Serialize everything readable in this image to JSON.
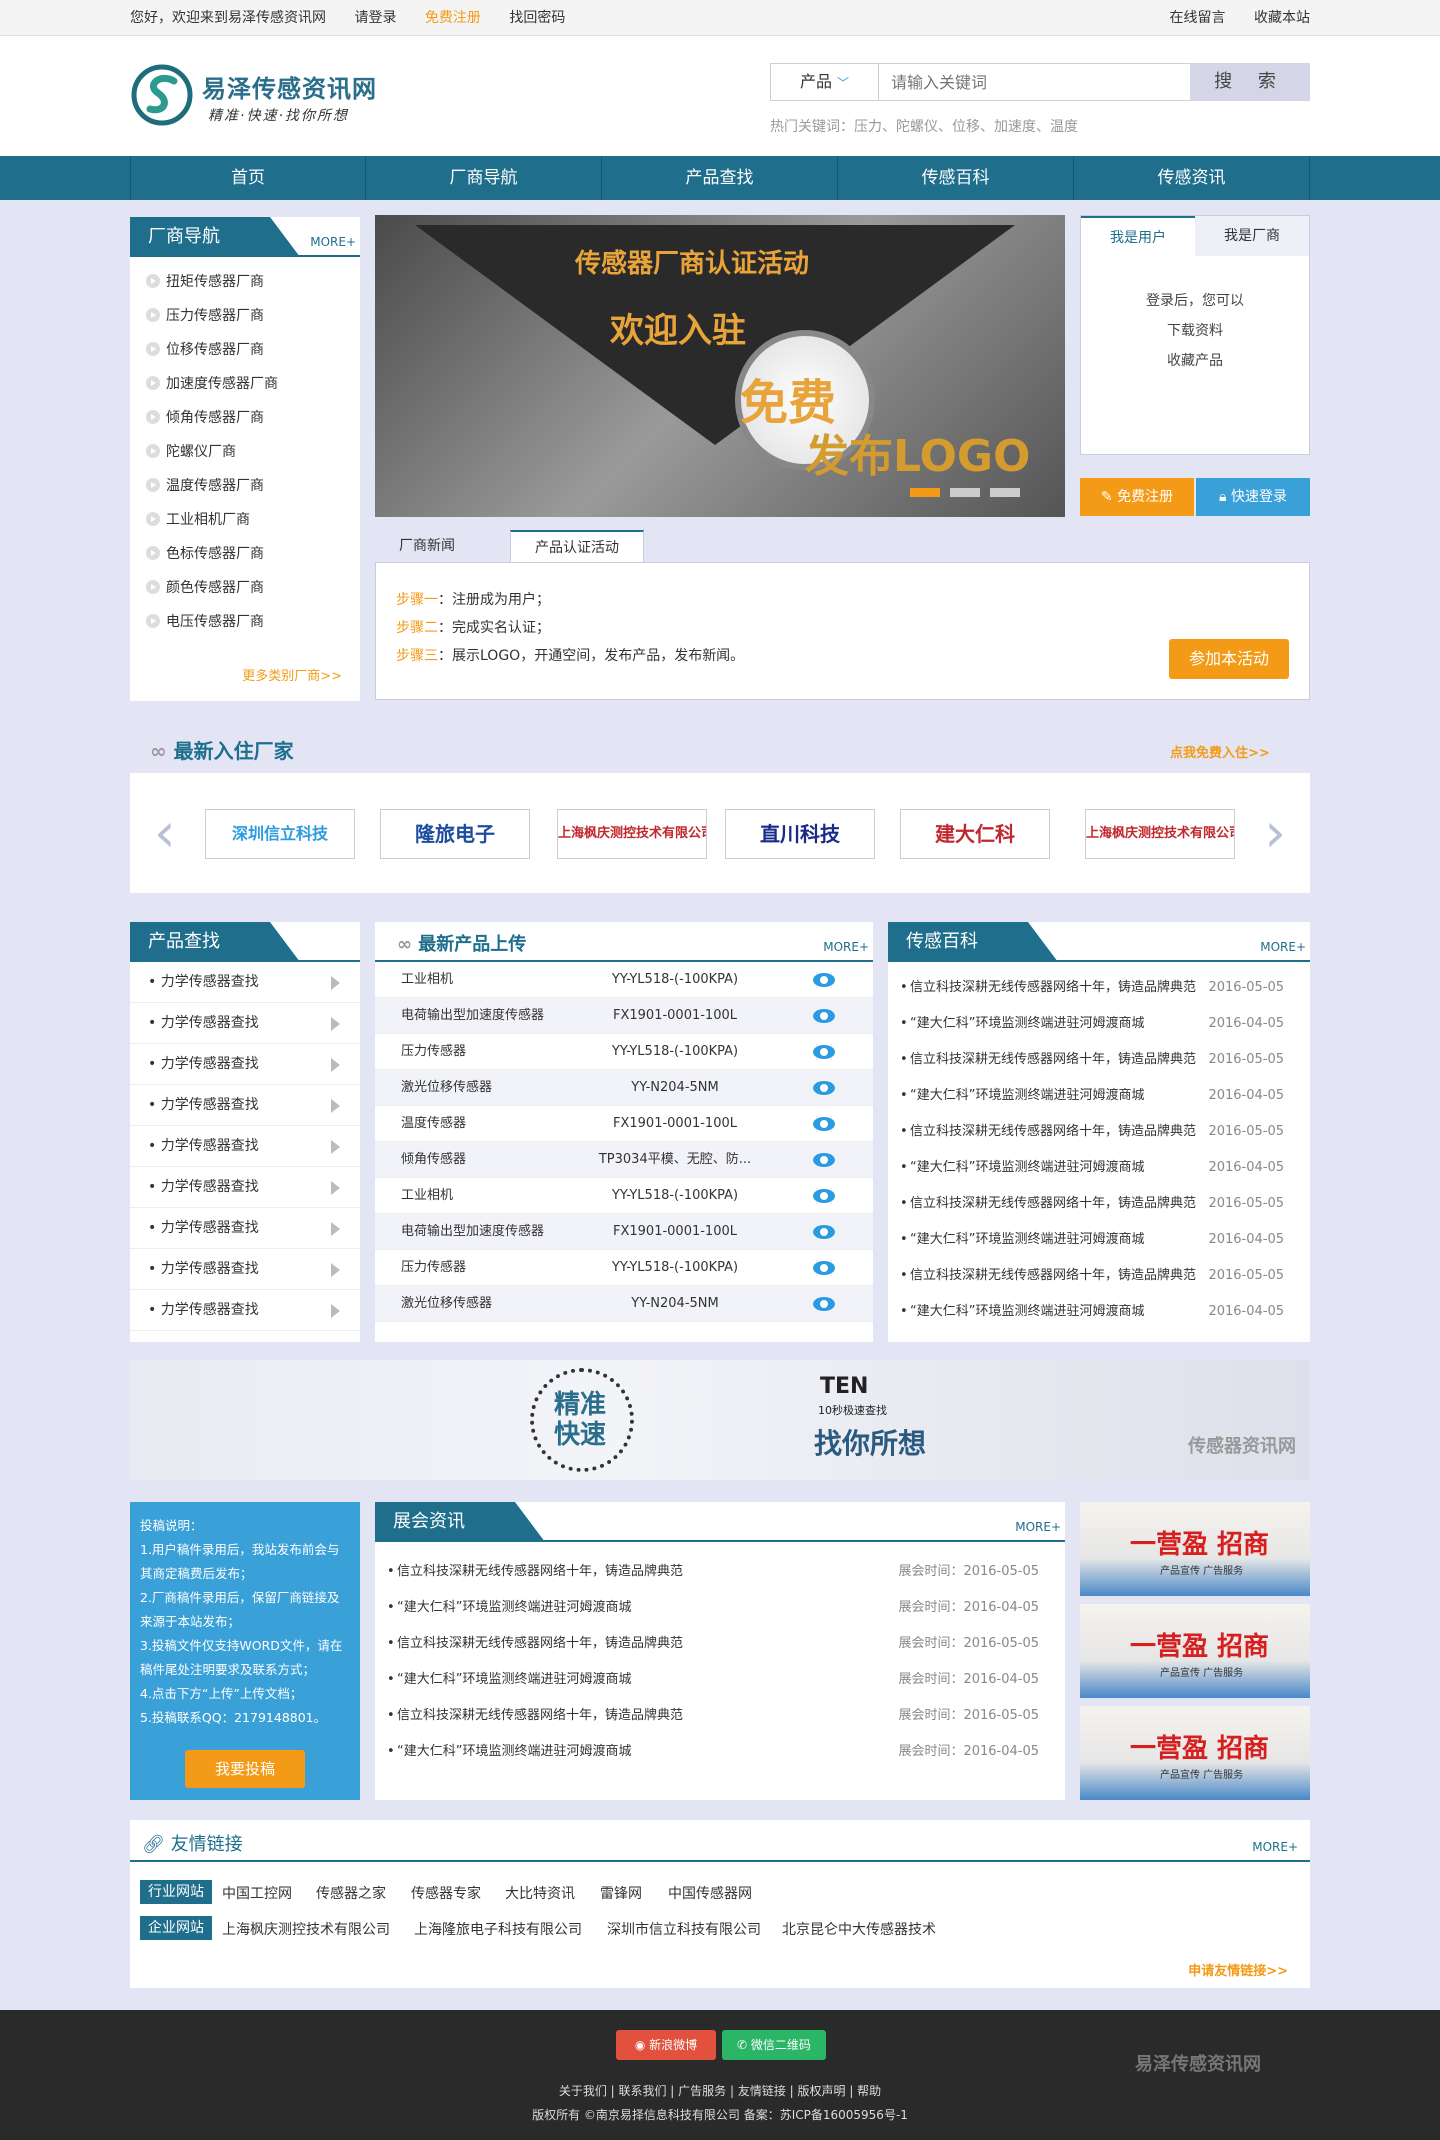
{
  "topbar": {
    "welcome": "您好，欢迎来到易泽传感资讯网",
    "login": "请登录",
    "register": "免费注册",
    "recover": "找回密码",
    "message": "在线留言",
    "bookmark": "收藏本站"
  },
  "header": {
    "site_name": "易泽传感资讯网",
    "slogan": "精准·快速·找你所想",
    "search_category": "产品",
    "search_placeholder": "请输入关键词",
    "search_button": "搜 索",
    "hot_keywords": "热门关键词：压力、陀螺仪、位移、加速度、温度"
  },
  "nav": [
    "首页",
    "厂商导航",
    "产品查找",
    "传感百科",
    "传感资讯"
  ],
  "vendor_nav": {
    "title": "厂商导航",
    "more": "MORE+",
    "items": [
      "扭矩传感器厂商",
      "压力传感器厂商",
      "位移传感器厂商",
      "加速度传感器厂商",
      "倾角传感器厂商",
      "陀螺仪厂商",
      "温度传感器厂商",
      "工业相机厂商",
      "色标传感器厂商",
      "颜色传感器厂商",
      "电压传感器厂商"
    ],
    "more_categories": "更多类别厂商>>"
  },
  "banner": {
    "line1": "传感器厂商认证活动",
    "line2": "欢迎入驻",
    "line3": "免费",
    "line4": "发布LOGO"
  },
  "userbox": {
    "tab_user": "我是用户",
    "tab_vendor": "我是厂商",
    "info": [
      "登录后，您可以",
      "下载资料",
      "收藏产品"
    ],
    "register_btn": "免费注册",
    "login_btn": "快速登录"
  },
  "activity": {
    "tab_news": "厂商新闻",
    "tab_cert": "产品认证活动",
    "steps": [
      {
        "label": "步骤一",
        "text": "：注册成为用户；"
      },
      {
        "label": "步骤二",
        "text": "：完成实名认证；"
      },
      {
        "label": "步骤三",
        "text": "：展示LOGO，开通空间，发布产品，发布新闻。"
      }
    ],
    "join_btn": "参加本活动"
  },
  "latest_vendors": {
    "title": "最新入住厂家",
    "link": "点我免费入住>>",
    "logos": [
      "深圳信立科技",
      "隆旅电子",
      "上海枫庆测控技术有限公司",
      "直川科技",
      "建大仁科",
      "上海枫庆测控技术有限公司"
    ]
  },
  "product_find": {
    "title": "产品查找",
    "items": [
      "力学传感器查找",
      "力学传感器查找",
      "力学传感器查找",
      "力学传感器查找",
      "力学传感器查找",
      "力学传感器查找",
      "力学传感器查找",
      "力学传感器查找",
      "力学传感器查找"
    ]
  },
  "new_products": {
    "title": "最新产品上传",
    "more": "MORE+",
    "rows": [
      {
        "name": "工业相机",
        "model": "YY-YL518-(-100KPA)"
      },
      {
        "name": "电荷输出型加速度传感器",
        "model": "FX1901-0001-100L"
      },
      {
        "name": "压力传感器",
        "model": "YY-YL518-(-100KPA)"
      },
      {
        "name": "激光位移传感器",
        "model": "YY-N204-5NM"
      },
      {
        "name": "温度传感器",
        "model": "FX1901-0001-100L"
      },
      {
        "name": "倾角传感器",
        "model": "TP3034平模、无腔、防..."
      },
      {
        "name": "工业相机",
        "model": "YY-YL518-(-100KPA)"
      },
      {
        "name": "电荷输出型加速度传感器",
        "model": "FX1901-0001-100L"
      },
      {
        "name": "压力传感器",
        "model": "YY-YL518-(-100KPA)"
      },
      {
        "name": "激光位移传感器",
        "model": "YY-N204-5NM"
      }
    ]
  },
  "encyclopedia": {
    "title": "传感百科",
    "more": "MORE+",
    "rows": [
      {
        "text": "信立科技深耕无线传感器网络十年，铸造品牌典范",
        "date": "2016-05-05"
      },
      {
        "text": "“建大仁科”环境监测终端进驻河姆渡商城",
        "date": "2016-04-05"
      },
      {
        "text": "信立科技深耕无线传感器网络十年，铸造品牌典范",
        "date": "2016-05-05"
      },
      {
        "text": "“建大仁科”环境监测终端进驻河姆渡商城",
        "date": "2016-04-05"
      },
      {
        "text": "信立科技深耕无线传感器网络十年，铸造品牌典范",
        "date": "2016-05-05"
      },
      {
        "text": "“建大仁科”环境监测终端进驻河姆渡商城",
        "date": "2016-04-05"
      },
      {
        "text": "信立科技深耕无线传感器网络十年，铸造品牌典范",
        "date": "2016-05-05"
      },
      {
        "text": "“建大仁科”环境监测终端进驻河姆渡商城",
        "date": "2016-04-05"
      },
      {
        "text": "信立科技深耕无线传感器网络十年，铸造品牌典范",
        "date": "2016-05-05"
      },
      {
        "text": "“建大仁科”环境监测终端进驻河姆渡商城",
        "date": "2016-04-05"
      }
    ]
  },
  "wide_banner": {
    "left": "精准快速",
    "ten": "TEN",
    "ten_sub": "10秒极速查找",
    "right": "找你所想",
    "brand": "传感器资讯网"
  },
  "submission": {
    "lines": [
      "投稿说明：",
      "1.用户稿件录用后，我站发布前会与其商定稿费后发布；",
      "2.厂商稿件录用后，保留厂商链接及来源于本站发布；",
      "3.投稿文件仅支持WORD文件，请在稿件尾处注明要求及联系方式；",
      "4.点击下方“上传”上传文档；",
      "5.投稿联系QQ：2179148801。"
    ],
    "button": "我要投稿"
  },
  "exhibition": {
    "title": "展会资讯",
    "more": "MORE+",
    "rows": [
      {
        "text": "信立科技深耕无线传感器网络十年，铸造品牌典范",
        "date": "展会时间：2016-05-05"
      },
      {
        "text": "“建大仁科”环境监测终端进驻河姆渡商城",
        "date": "展会时间：2016-04-05"
      },
      {
        "text": "信立科技深耕无线传感器网络十年，铸造品牌典范",
        "date": "展会时间：2016-05-05"
      },
      {
        "text": "“建大仁科”环境监测终端进驻河姆渡商城",
        "date": "展会时间：2016-04-05"
      },
      {
        "text": "信立科技深耕无线传感器网络十年，铸造品牌典范",
        "date": "展会时间：2016-05-05"
      },
      {
        "text": "“建大仁科”环境监测终端进驻河姆渡商城",
        "date": "展会时间：2016-04-05"
      }
    ]
  },
  "ads": [
    {
      "title": "一营盈 招商",
      "sub": "产品宣传 广告服务"
    },
    {
      "title": "一营盈 招商",
      "sub": "产品宣传 广告服务"
    },
    {
      "title": "一营盈 招商",
      "sub": "产品宣传 广告服务"
    }
  ],
  "friend_links": {
    "title": "友情链接",
    "more": "MORE+",
    "industry_tag": "行业网站",
    "industry": [
      "中国工控网",
      "传感器之家",
      "传感器专家",
      "大比特资讯",
      "雷锋网",
      "中国传感器网"
    ],
    "company_tag": "企业网站",
    "company": [
      "上海枫庆测控技术有限公司",
      "上海隆旅电子科技有限公司",
      "深圳市信立科技有限公司",
      "北京昆仑中大传感器技术"
    ],
    "apply": "申请友情链接>>"
  },
  "footer": {
    "weibo": "新浪微博",
    "wechat": "微信二维码",
    "links": "关于我们 | 联系我们 | 广告服务 | 友情链接 | 版权声明 | 帮助",
    "copyright": "版权所有 ©南京易择信息科技有限公司   备案：苏ICP备16005956号-1",
    "logo": "易泽传感资讯网"
  },
  "colors": {
    "primary": "#1e6e8c",
    "accent": "#f39b17",
    "background": "#e3e5f5"
  }
}
